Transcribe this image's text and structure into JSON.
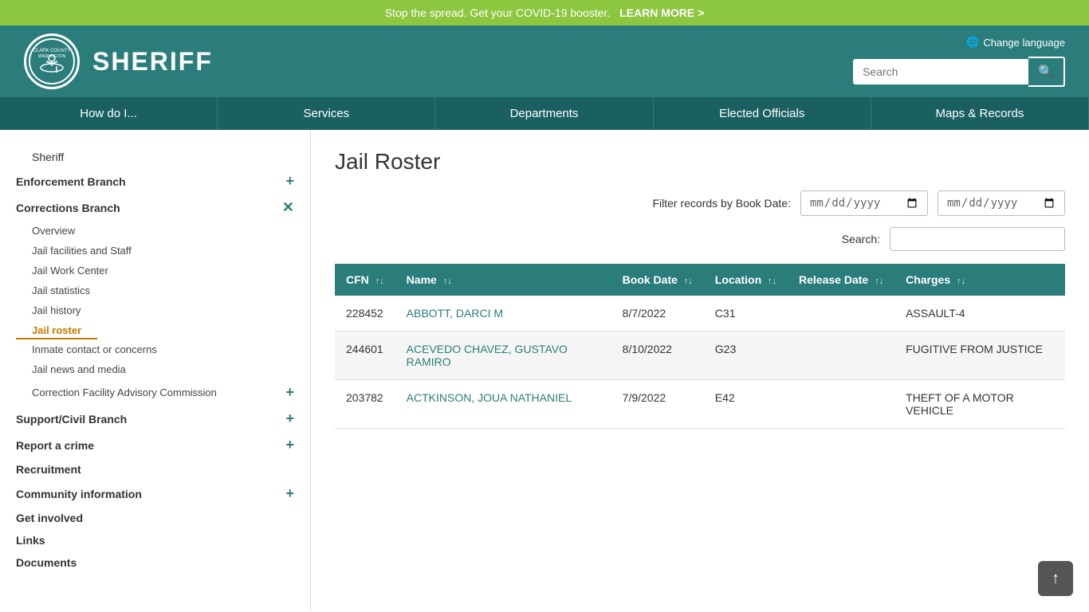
{
  "covid_banner": {
    "text": "Stop the spread. Get your COVID-19 booster.",
    "link_text": "LEARN MORE >"
  },
  "header": {
    "title": "SHERIFF",
    "change_language": "Change language",
    "search_placeholder": "Search"
  },
  "nav": {
    "items": [
      {
        "id": "how-do-i",
        "label": "How do I..."
      },
      {
        "id": "services",
        "label": "Services"
      },
      {
        "id": "departments",
        "label": "Departments"
      },
      {
        "id": "elected-officials",
        "label": "Elected Officials"
      },
      {
        "id": "maps-records",
        "label": "Maps & Records"
      }
    ]
  },
  "sidebar": {
    "top_links": [
      {
        "id": "sheriff",
        "label": "Sheriff"
      }
    ],
    "sections": [
      {
        "id": "enforcement-branch",
        "label": "Enforcement Branch",
        "expandable": true,
        "icon": "plus"
      },
      {
        "id": "corrections-branch",
        "label": "Corrections Branch",
        "expandable": true,
        "icon": "close",
        "children": [
          {
            "id": "overview",
            "label": "Overview",
            "active": false
          },
          {
            "id": "jail-facilities",
            "label": "Jail facilities and Staff",
            "active": false
          },
          {
            "id": "jail-work-center",
            "label": "Jail Work Center",
            "active": false
          },
          {
            "id": "jail-statistics",
            "label": "Jail statistics",
            "active": false
          },
          {
            "id": "jail-history",
            "label": "Jail history",
            "active": false
          },
          {
            "id": "jail-roster",
            "label": "Jail roster",
            "active": true
          },
          {
            "id": "inmate-contact",
            "label": "Inmate contact or concerns",
            "active": false
          },
          {
            "id": "jail-news",
            "label": "Jail news and media",
            "active": false
          },
          {
            "id": "correction-facility-advisory",
            "label": "Correction Facility Advisory Commission",
            "active": false,
            "expandable": true
          }
        ]
      },
      {
        "id": "support-civil-branch",
        "label": "Support/Civil Branch",
        "expandable": true,
        "icon": "plus"
      },
      {
        "id": "report-crime",
        "label": "Report a crime",
        "expandable": true,
        "icon": "plus"
      },
      {
        "id": "recruitment",
        "label": "Recruitment",
        "expandable": false
      },
      {
        "id": "community-info",
        "label": "Community information",
        "expandable": true,
        "icon": "plus"
      },
      {
        "id": "get-involved",
        "label": "Get involved",
        "expandable": false
      },
      {
        "id": "links",
        "label": "Links",
        "expandable": false
      },
      {
        "id": "documents",
        "label": "Documents",
        "expandable": false
      }
    ]
  },
  "main": {
    "page_title": "Jail Roster",
    "filter_label": "Filter records by Book Date:",
    "search_label": "Search:",
    "date_placeholder1": "mm/dd/yyyy",
    "date_placeholder2": "mm/dd/yyyy",
    "table": {
      "columns": [
        {
          "id": "cfn",
          "label": "CFN"
        },
        {
          "id": "name",
          "label": "Name"
        },
        {
          "id": "book-date",
          "label": "Book Date"
        },
        {
          "id": "location",
          "label": "Location"
        },
        {
          "id": "release-date",
          "label": "Release Date"
        },
        {
          "id": "charges",
          "label": "Charges"
        }
      ],
      "rows": [
        {
          "cfn": "228452",
          "name": "ABBOTT, DARCI M",
          "book_date": "8/7/2022",
          "location": "C31",
          "release_date": "",
          "charges": "ASSAULT-4"
        },
        {
          "cfn": "244601",
          "name": "ACEVEDO CHAVEZ, GUSTAVO RAMIRO",
          "book_date": "8/10/2022",
          "location": "G23",
          "release_date": "",
          "charges": "FUGITIVE FROM JUSTICE"
        },
        {
          "cfn": "203782",
          "name": "ACTKINSON, JOUA NATHANIEL",
          "book_date": "7/9/2022",
          "location": "E42",
          "release_date": "",
          "charges": "THEFT OF A MOTOR VEHICLE"
        }
      ]
    }
  },
  "scroll_top_icon": "↑"
}
